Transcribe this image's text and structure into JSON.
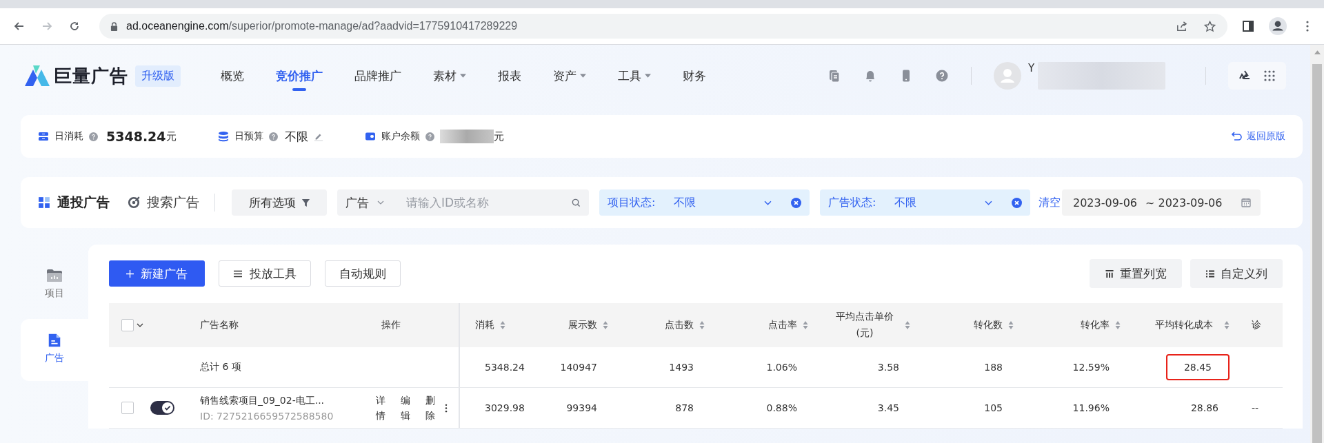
{
  "browser": {
    "url_host": "ad.oceanengine.com",
    "url_path": "/superior/promote-manage/ad?aadvid=1775910417289229"
  },
  "header": {
    "logo": "巨量广告",
    "edition_badge": "升级版",
    "nav": [
      {
        "label": "概览",
        "selected": false,
        "has_menu": false
      },
      {
        "label": "竞价推广",
        "selected": true,
        "has_menu": false
      },
      {
        "label": "品牌推广",
        "selected": false,
        "has_menu": false
      },
      {
        "label": "素材",
        "selected": false,
        "has_menu": true
      },
      {
        "label": "报表",
        "selected": false,
        "has_menu": false
      },
      {
        "label": "资产",
        "selected": false,
        "has_menu": true
      },
      {
        "label": "工具",
        "selected": false,
        "has_menu": true
      },
      {
        "label": "财务",
        "selected": false,
        "has_menu": false
      }
    ],
    "user_initial": "Y"
  },
  "stats": {
    "daily_spend_label": "日消耗",
    "daily_spend": "5348.24",
    "daily_spend_unit": "元",
    "budget_label": "日预算",
    "budget": "不限",
    "balance_label": "账户余额",
    "balance_unit": "元",
    "back_link": "返回原版"
  },
  "filters": {
    "tabs": [
      {
        "label": "通投广告",
        "selected": true
      },
      {
        "label": "搜索广告",
        "selected": false
      }
    ],
    "all_options": "所有选项",
    "search_scope": "广告",
    "search_placeholder": "请输入ID或名称",
    "selects": [
      {
        "label": "项目状态:",
        "value": "不限"
      },
      {
        "label": "广告状态:",
        "value": "不限"
      }
    ],
    "clear": "清空",
    "date_start": "2023-09-06",
    "date_end": "~ 2023-09-06"
  },
  "side_nav": [
    {
      "label": "项目",
      "selected": false
    },
    {
      "label": "广告",
      "selected": true
    }
  ],
  "toolbar": {
    "primary": "新建广告",
    "buttons": [
      "投放工具",
      "自动规则"
    ],
    "right_buttons": [
      "重置列宽",
      "自定义列"
    ]
  },
  "table": {
    "select_all_checked": false,
    "fixed_columns": [
      "广告名称",
      "操作"
    ],
    "columns": [
      {
        "label": "消耗",
        "sortable": true
      },
      {
        "label": "展示数",
        "sortable": true
      },
      {
        "label": "点击数",
        "sortable": true
      },
      {
        "label": "点击率",
        "sortable": true
      },
      {
        "label": "平均点击单价(元)",
        "sortable": true
      },
      {
        "label": "转化数",
        "sortable": true
      },
      {
        "label": "转化率",
        "sortable": true
      },
      {
        "label": "平均转化成本",
        "sortable": true
      },
      {
        "label": "诊",
        "sortable": false
      }
    ],
    "total": {
      "label": "总计 6 项",
      "cells": [
        {
          "text": "5348.24",
          "highlighted": false
        },
        {
          "text": "140947",
          "highlighted": false
        },
        {
          "text": "1493",
          "highlighted": false
        },
        {
          "text": "1.06%",
          "highlighted": false
        },
        {
          "text": "3.58",
          "highlighted": false
        },
        {
          "text": "188",
          "highlighted": false
        },
        {
          "text": "12.59%",
          "highlighted": false
        },
        {
          "text": "28.45",
          "highlighted": true
        }
      ]
    },
    "rows": [
      {
        "name": "销售线索项目_09_02-电工...",
        "id": "ID: 7275216659572588580",
        "checked": false,
        "on": true,
        "ops": [
          "详情",
          "编辑",
          "删除"
        ],
        "values": [
          "3029.98",
          "99394",
          "878",
          "0.88%",
          "3.45",
          "105",
          "11.96%",
          "28.86",
          "--"
        ]
      }
    ]
  }
}
